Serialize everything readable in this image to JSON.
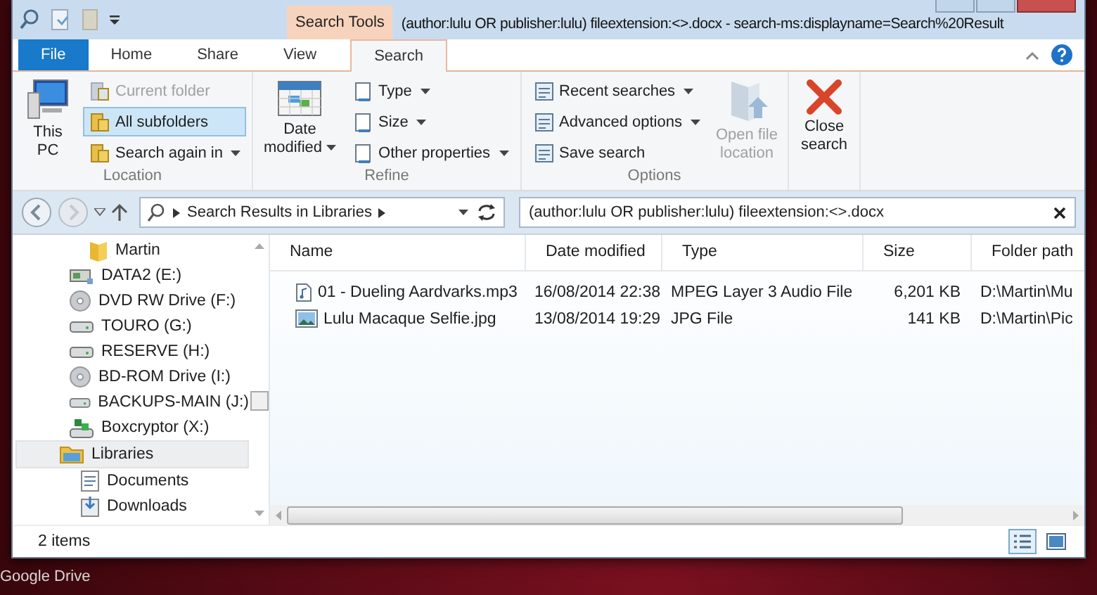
{
  "window": {
    "context_tab_header": "Search Tools",
    "title": "(author:lulu OR publisher:lulu) fileextension:<>.docx - search-ms:displayname=Search%20Result"
  },
  "ribbon": {
    "tabs": [
      {
        "label": "File",
        "kind": "file",
        "selected": false
      },
      {
        "label": "Home",
        "kind": "plain",
        "selected": false
      },
      {
        "label": "Share",
        "kind": "plain",
        "selected": false
      },
      {
        "label": "View",
        "kind": "plain",
        "selected": false
      },
      {
        "label": "Search",
        "kind": "contextual",
        "selected": true
      }
    ],
    "groups": [
      {
        "label": "Location",
        "items": [
          {
            "label": "This\nPC",
            "kind": "large",
            "dropdown": false,
            "disabled": false,
            "selected": false
          },
          {
            "label": "Current folder",
            "kind": "small",
            "dropdown": false,
            "disabled": true,
            "selected": false
          },
          {
            "label": "All subfolders",
            "kind": "small",
            "dropdown": false,
            "disabled": false,
            "selected": true
          },
          {
            "label": "Search again in",
            "kind": "small",
            "dropdown": true,
            "disabled": false,
            "selected": false
          }
        ]
      },
      {
        "label": "Refine",
        "items": [
          {
            "label": "Date\nmodified",
            "kind": "large",
            "dropdown": true,
            "disabled": false,
            "selected": false
          },
          {
            "label": "Type",
            "kind": "small",
            "dropdown": true,
            "disabled": false,
            "selected": false
          },
          {
            "label": "Size",
            "kind": "small",
            "dropdown": true,
            "disabled": false,
            "selected": false
          },
          {
            "label": "Other properties",
            "kind": "small",
            "dropdown": true,
            "disabled": false,
            "selected": false
          }
        ]
      },
      {
        "label": "Options",
        "items": [
          {
            "label": "Recent searches",
            "kind": "small",
            "dropdown": true,
            "disabled": false,
            "selected": false
          },
          {
            "label": "Advanced options",
            "kind": "small",
            "dropdown": true,
            "disabled": false,
            "selected": false
          },
          {
            "label": "Save search",
            "kind": "small",
            "dropdown": false,
            "disabled": false,
            "selected": false
          },
          {
            "label": "Open file\nlocation",
            "kind": "large",
            "dropdown": false,
            "disabled": true,
            "selected": false
          }
        ]
      },
      {
        "items": [
          {
            "label": "Close\nsearch",
            "kind": "large",
            "dropdown": false,
            "disabled": false,
            "selected": false
          }
        ]
      }
    ]
  },
  "address_bar": {
    "location": "Search Results in Libraries",
    "search": {
      "value": "(author:lulu OR publisher:lulu) fileextension:<>.docx"
    }
  },
  "nav_pane": {
    "items": [
      {
        "label": "Martin",
        "kind": "folder",
        "selected": false
      },
      {
        "label": "DATA2 (E:)",
        "kind": "network-drive",
        "selected": false
      },
      {
        "label": "DVD RW Drive (F:)",
        "kind": "disc-drive",
        "selected": false
      },
      {
        "label": "TOURO (G:)",
        "kind": "drive",
        "selected": false
      },
      {
        "label": "RESERVE (H:)",
        "kind": "drive",
        "selected": false
      },
      {
        "label": "BD-ROM Drive (I:)",
        "kind": "disc-drive",
        "selected": false
      },
      {
        "label": "BACKUPS-MAIN (J:)",
        "kind": "drive",
        "selected": false
      },
      {
        "label": "Boxcryptor (X:)",
        "kind": "app-drive",
        "selected": false
      },
      {
        "label": "Libraries",
        "kind": "libraries",
        "selected": true,
        "children": [
          {
            "label": "Documents",
            "kind": "documents",
            "selected": false
          },
          {
            "label": "Downloads",
            "kind": "downloads",
            "selected": false
          }
        ]
      }
    ]
  },
  "file_list": {
    "columns": [
      "Name",
      "Date modified",
      "Type",
      "Size",
      "Folder path"
    ],
    "rows": [
      {
        "kind": "audio",
        "selected": false,
        "cells": [
          "01 - Dueling Aardvarks.mp3",
          "16/08/2014 22:38",
          "MPEG Layer 3 Audio File",
          "6,201 KB",
          "D:\\Martin\\Mu"
        ]
      },
      {
        "kind": "image",
        "selected": false,
        "cells": [
          "Lulu Macaque Selfie.jpg",
          "13/08/2014 19:29",
          "JPG File",
          "141 KB",
          "D:\\Martin\\Pic"
        ]
      }
    ]
  },
  "status_bar": {
    "item_count": "2 items",
    "views": [
      {
        "kind": "details",
        "selected": true
      },
      {
        "kind": "large-icons",
        "selected": false
      }
    ]
  },
  "desktop": {
    "label": "Google Drive"
  }
}
